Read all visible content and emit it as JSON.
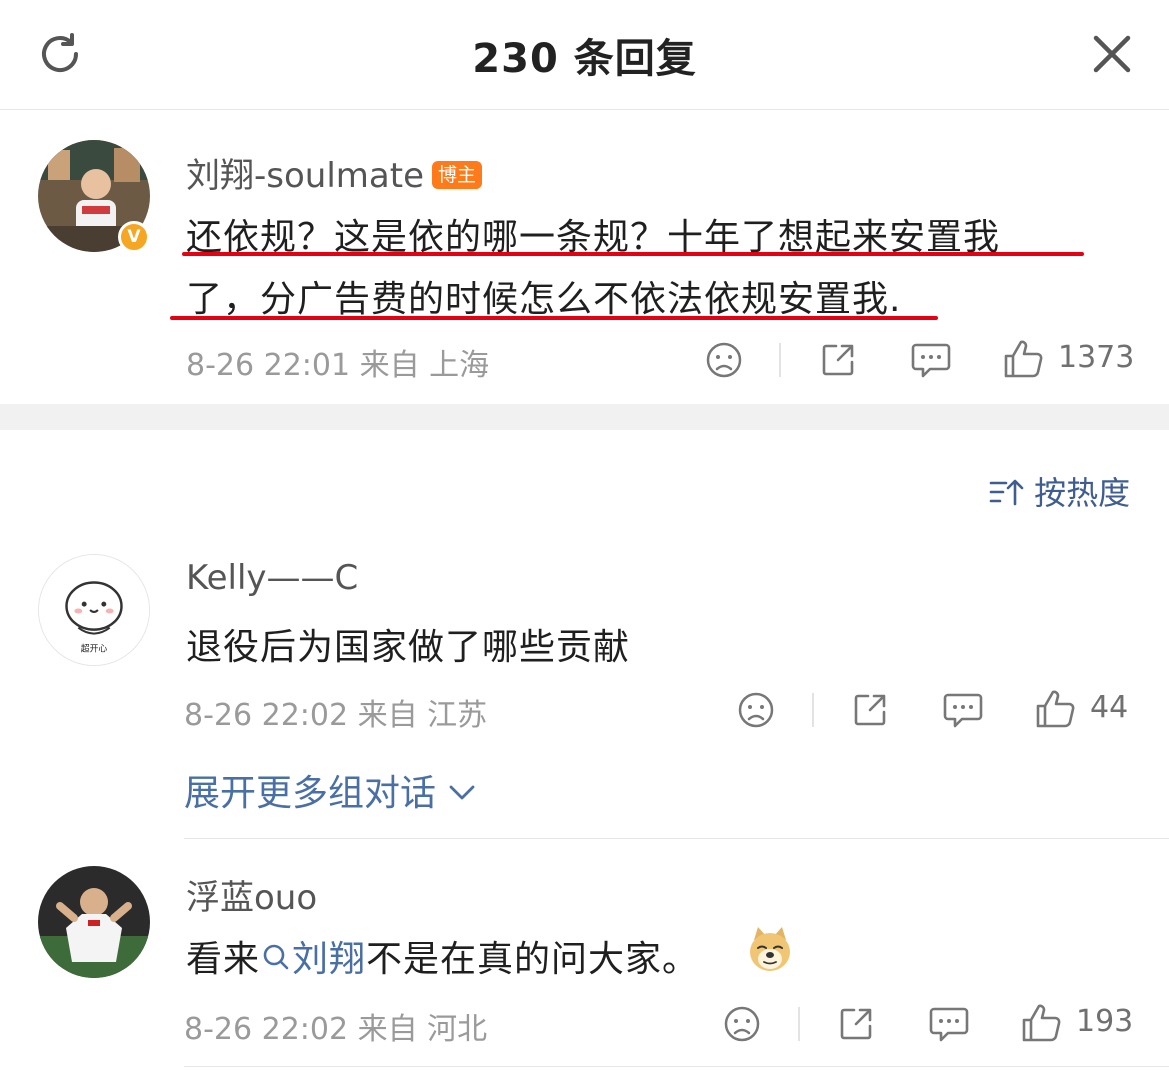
{
  "header": {
    "title": "230 条回复"
  },
  "root_comment": {
    "author": "刘翔-soulmate",
    "author_tag": "博主",
    "verified_badge": "V",
    "text_line1": "还依规？这是依的哪一条规？十年了想起来安置我",
    "text_line2": "了，分广告费的时候怎么不依法依规安置我.",
    "date": "8-26 22:01",
    "location": "来自 上海",
    "likes": "1373"
  },
  "sort_label": "按热度",
  "replies": [
    {
      "author": "Kelly——C",
      "text": "退役后为国家做了哪些贡献",
      "avatar_caption": "超开心",
      "date": "8-26 22:02",
      "location": "来自 江苏",
      "likes": "44"
    },
    {
      "author": "浮蓝ouo",
      "text_before": "看来",
      "mention": "刘翔",
      "text_after": "不是在真的问大家。",
      "date": "8-26 22:02",
      "location": "来自 河北",
      "likes": "193"
    }
  ],
  "expand_label": "展开更多组对话",
  "colors": {
    "underline": "#e60012",
    "link": "#4a6fa5",
    "boss_tag": "#ff7a1a",
    "verified": "#f5a623"
  },
  "icons": [
    "refresh-icon",
    "close-icon",
    "sad-face-icon",
    "share-icon",
    "comment-icon",
    "thumbs-up-icon",
    "sort-icon",
    "chevron-down-icon",
    "search-icon",
    "doge-emoji-icon"
  ]
}
